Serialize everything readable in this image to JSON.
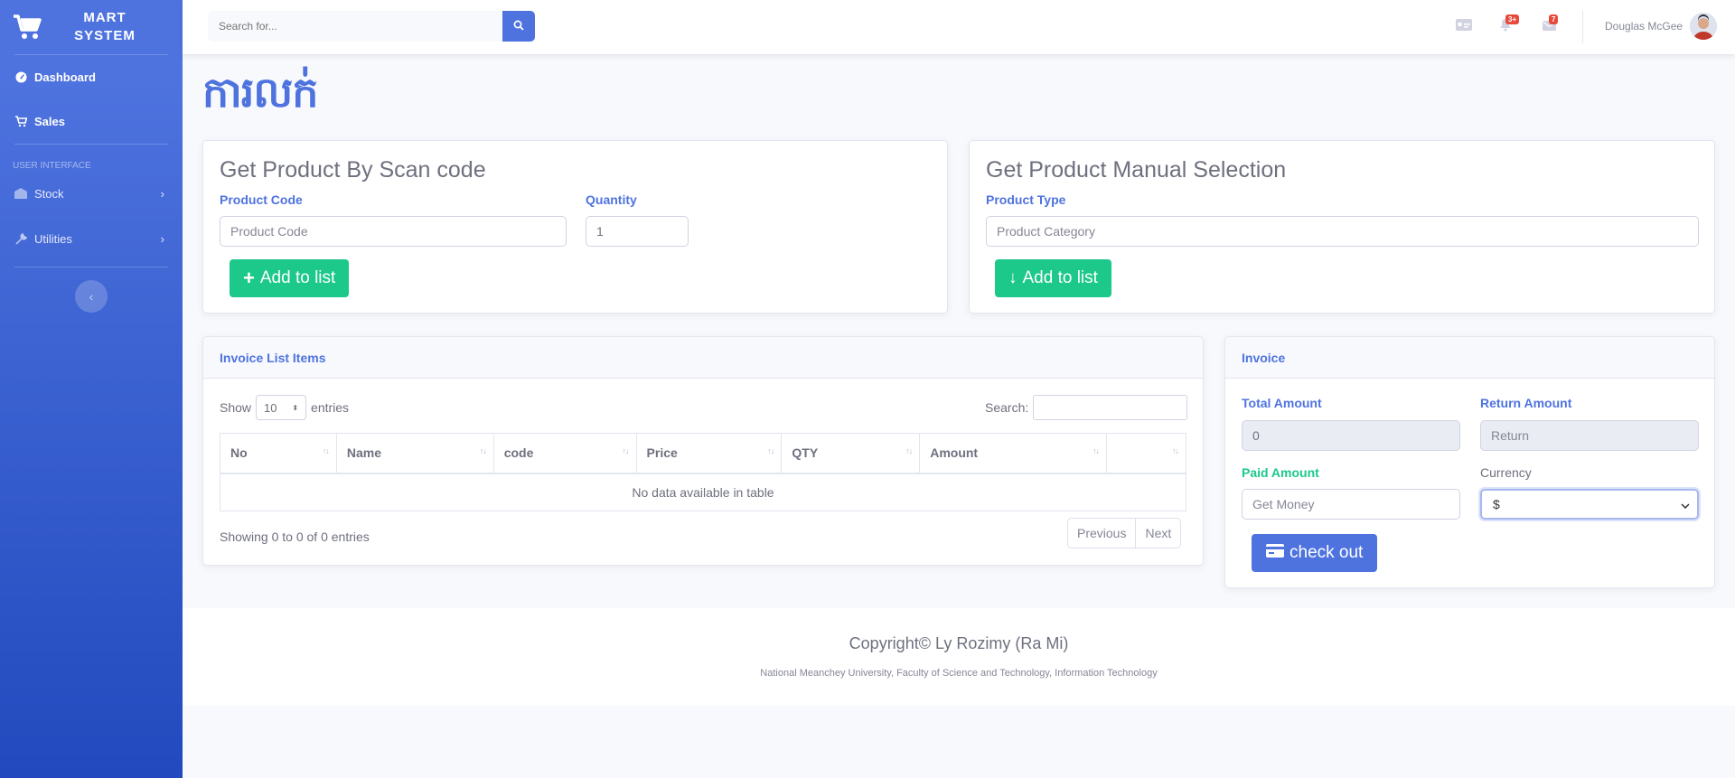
{
  "brand": {
    "line1": "MART",
    "line2": "SYSTEM"
  },
  "sidebar": {
    "items": [
      {
        "label": "Dashboard",
        "icon": "tachometer-icon"
      },
      {
        "label": "Sales",
        "icon": "cart-icon"
      }
    ],
    "section_heading": "USER INTERFACE",
    "collapsible": [
      {
        "label": "Stock",
        "icon": "warehouse-icon"
      },
      {
        "label": "Utilities",
        "icon": "wrench-icon"
      }
    ]
  },
  "topbar": {
    "search_placeholder": "Search for...",
    "alerts_badge": "3+",
    "messages_badge": "7",
    "user_name": "Douglas McGee"
  },
  "page_title": "ការលក់",
  "scan_card": {
    "title": "Get Product By Scan code",
    "product_code_label": "Product Code",
    "product_code_placeholder": "Product Code",
    "quantity_label": "Quantity",
    "quantity_value": "1",
    "add_button": "Add to list"
  },
  "manual_card": {
    "title": "Get Product Manual Selection",
    "product_type_label": "Product Type",
    "product_type_placeholder": "Product Category",
    "add_button": "Add to list"
  },
  "invoice_list": {
    "header": "Invoice List Items",
    "show_label": "Show",
    "entries_value": "10",
    "entries_label": "entries",
    "search_label": "Search:",
    "columns": [
      "No",
      "Name",
      "code",
      "Price",
      "QTY",
      "Amount",
      ""
    ],
    "empty_message": "No data available in table",
    "info": "Showing 0 to 0 of 0 entries",
    "prev": "Previous",
    "next": "Next"
  },
  "invoice": {
    "header": "Invoice",
    "total_label": "Total Amount",
    "total_value": "0",
    "return_label": "Return Amount",
    "return_placeholder": "Return",
    "paid_label": "Paid Amount",
    "paid_placeholder": "Get Money",
    "currency_label": "Currency",
    "currency_value": "$",
    "checkout_button": "check out"
  },
  "footer": {
    "copyright": "Copyright© Ly Rozimy (Ra Mi)",
    "institution": "National Meanchey University, Faculty of Science and Technology, Information Technology"
  },
  "colors": {
    "primary": "#4e73df",
    "success": "#1cc88a",
    "danger": "#e74a3b"
  }
}
